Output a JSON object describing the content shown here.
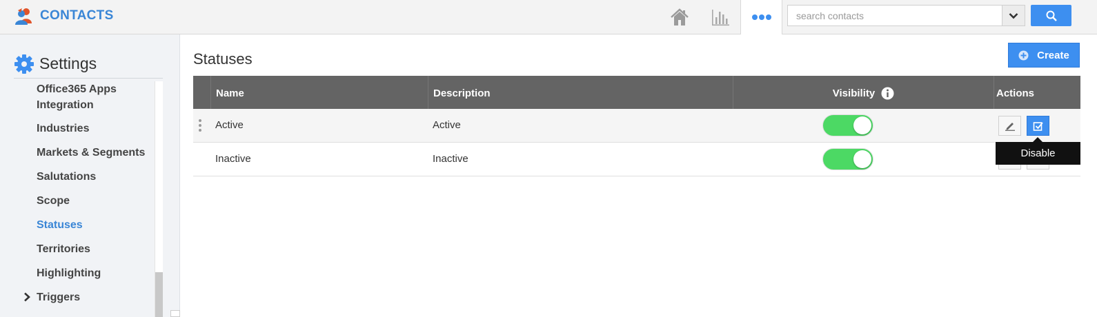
{
  "app": {
    "title": "CONTACTS",
    "logo": "contacts-people-icon",
    "accent": "#3a86d6"
  },
  "topbar": {
    "nav_icons": [
      "home-icon",
      "reports-icon",
      "more-icon"
    ],
    "search": {
      "placeholder": "search contacts",
      "value": ""
    }
  },
  "sidebar": {
    "heading": "Settings",
    "items": [
      {
        "label": "Office365 Apps"
      },
      {
        "label": "Integration"
      },
      {
        "label": "Industries"
      },
      {
        "label": "Markets & Segments"
      },
      {
        "label": "Salutations"
      },
      {
        "label": "Scope"
      },
      {
        "label": "Statuses",
        "active": true
      },
      {
        "label": "Territories"
      },
      {
        "label": "Highlighting"
      },
      {
        "label": "Triggers",
        "expandable": true
      }
    ]
  },
  "main": {
    "title": "Statuses",
    "create_label": "Create",
    "table": {
      "columns": [
        "Name",
        "Description",
        "Visibility",
        "Actions"
      ],
      "rows": [
        {
          "name": "Active",
          "description": "Active",
          "visible": true
        },
        {
          "name": "Inactive",
          "description": "Inactive",
          "visible": true
        }
      ]
    },
    "tooltip": "Disable"
  },
  "colors": {
    "primary_button": "#3d8ff0",
    "header_bg": "#646464",
    "toggle_on": "#4cd964"
  }
}
